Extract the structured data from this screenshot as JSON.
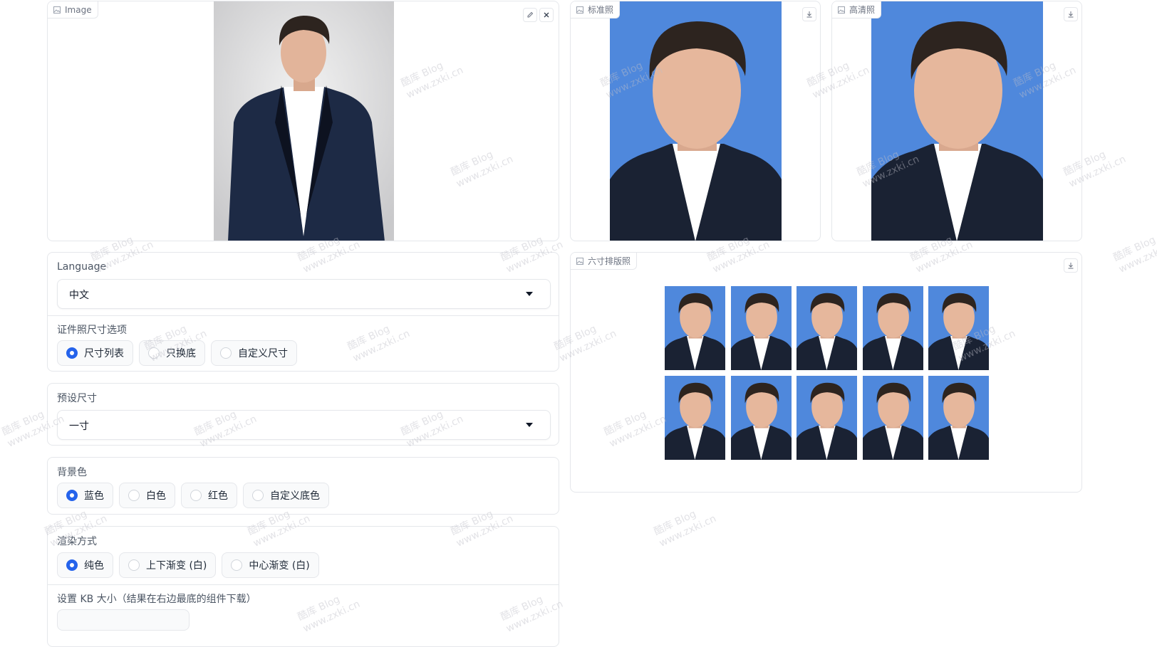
{
  "input_image": {
    "label": "Image",
    "icons": [
      "image-icon",
      "edit-icon",
      "close-icon"
    ]
  },
  "standard_photo": {
    "label": "标准照",
    "icons": [
      "image-icon",
      "download-icon"
    ]
  },
  "hd_photo": {
    "label": "高清照",
    "icons": [
      "image-icon",
      "download-icon"
    ]
  },
  "layout_photo": {
    "label": "六寸排版照",
    "icons": [
      "image-icon",
      "download-icon"
    ],
    "rows": 2,
    "cols": 5
  },
  "language": {
    "label": "Language",
    "value": "中文"
  },
  "size_option": {
    "label": "证件照尺寸选项",
    "options": [
      "尺寸列表",
      "只换底",
      "自定义尺寸"
    ],
    "selected": "尺寸列表"
  },
  "preset_size": {
    "label": "预设尺寸",
    "value": "一寸"
  },
  "background": {
    "label": "背景色",
    "options": [
      "蓝色",
      "白色",
      "红色",
      "自定义底色"
    ],
    "selected": "蓝色",
    "colors": {
      "blue": "#4f88dc"
    }
  },
  "render": {
    "label": "渲染方式",
    "options": [
      "纯色",
      "上下渐变 (白)",
      "中心渐变 (白)"
    ],
    "selected": "纯色"
  },
  "kb_size": {
    "label": "设置 KB 大小（结果在右边最底的组件下载）"
  },
  "watermark": {
    "line1": "酷库 Blog",
    "line2": "www.zxki.cn"
  },
  "colors": {
    "accent": "#2563eb",
    "border": "#e5e7eb"
  }
}
